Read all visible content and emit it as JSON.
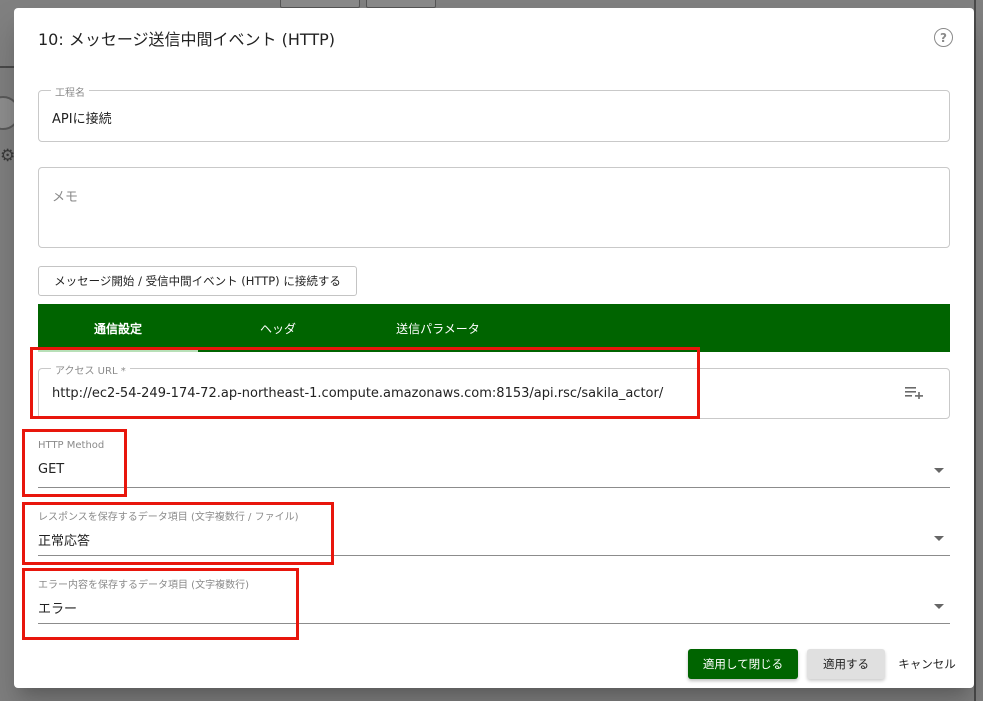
{
  "dialog": {
    "title": "10: メッセージ送信中間イベント (HTTP)",
    "help_icon": "?"
  },
  "step_name": {
    "label": "工程名",
    "value": "APIに接続"
  },
  "memo": {
    "placeholder": "メモ"
  },
  "connect_button": {
    "label": "メッセージ開始 / 受信中間イベント (HTTP) に接続する"
  },
  "tabs": [
    {
      "label": "通信設定",
      "active": true
    },
    {
      "label": "ヘッダ",
      "active": false
    },
    {
      "label": "送信パラメータ",
      "active": false
    }
  ],
  "access_url": {
    "label": "アクセス URL *",
    "value": "http://ec2-54-249-174-72.ap-northeast-1.compute.amazonaws.com:8153/api.rsc/sakila_actor/",
    "icon": "playlist-add-icon"
  },
  "http_method": {
    "label": "HTTP Method",
    "value": "GET"
  },
  "response_item": {
    "label": "レスポンスを保存するデータ項目 (文字複数行 / ファイル)",
    "value": "正常応答"
  },
  "error_item": {
    "label": "エラー内容を保存するデータ項目 (文字複数行)",
    "value": "エラー"
  },
  "footer": {
    "apply_close": "適用して閉じる",
    "apply": "適用する",
    "cancel": "キャンセル"
  },
  "colors": {
    "primary_green": "#006400",
    "highlight_red": "#e8160c"
  }
}
